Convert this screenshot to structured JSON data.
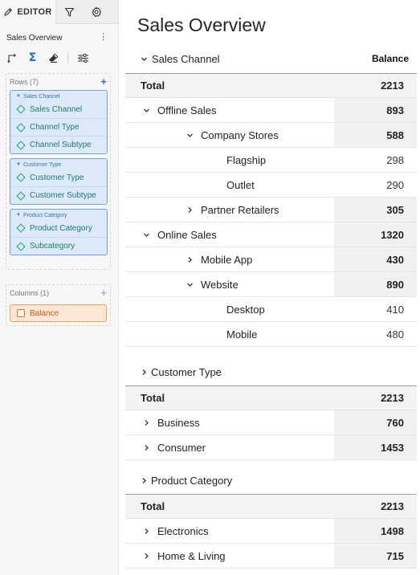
{
  "editor": {
    "tab_label": "EDITOR",
    "report_name": "Sales Overview",
    "tools": [
      "swap-axes-icon",
      "sigma-icon",
      "eraser-icon",
      "sliders-icon"
    ],
    "rows_header": "Rows (7)",
    "row_groups": [
      {
        "title": "Sales Channel",
        "fields": [
          "Sales Channel",
          "Channel Type",
          "Channel Subtype"
        ]
      },
      {
        "title": "Customer Type",
        "fields": [
          "Customer Type",
          "Customer Subtype"
        ]
      },
      {
        "title": "Product Category",
        "fields": [
          "Product Category",
          "Subcategory"
        ]
      }
    ],
    "columns_header": "Columns (1)",
    "measure": "Balance"
  },
  "report": {
    "title": "Sales Overview",
    "column_header": "Balance",
    "sections": [
      {
        "name": "Sales Channel",
        "expanded": true,
        "rows": [
          {
            "label": "Total",
            "value": "2213",
            "type": "total"
          },
          {
            "label": "Offline Sales",
            "value": "893",
            "level": 1,
            "chevron": "down"
          },
          {
            "label": "Company Stores",
            "value": "588",
            "level": 2,
            "chevron": "down"
          },
          {
            "label": "Flagship",
            "value": "298",
            "level": 3
          },
          {
            "label": "Outlet",
            "value": "290",
            "level": 3
          },
          {
            "label": "Partner Retailers",
            "value": "305",
            "level": 2,
            "chevron": "right"
          },
          {
            "label": "Online Sales",
            "value": "1320",
            "level": 1,
            "chevron": "down"
          },
          {
            "label": "Mobile App",
            "value": "430",
            "level": 2,
            "chevron": "right"
          },
          {
            "label": "Website",
            "value": "890",
            "level": 2,
            "chevron": "down"
          },
          {
            "label": "Desktop",
            "value": "410",
            "level": 3
          },
          {
            "label": "Mobile",
            "value": "480",
            "level": 3
          }
        ]
      },
      {
        "name": "Customer Type",
        "expanded": false,
        "rows": [
          {
            "label": "Total",
            "value": "2213",
            "type": "total"
          },
          {
            "label": "Business",
            "value": "760",
            "level": 1,
            "chevron": "right"
          },
          {
            "label": "Consumer",
            "value": "1453",
            "level": 1,
            "chevron": "right"
          }
        ]
      },
      {
        "name": "Product Category",
        "expanded": false,
        "rows": [
          {
            "label": "Total",
            "value": "2213",
            "type": "total"
          },
          {
            "label": "Electronics",
            "value": "1498",
            "level": 1,
            "chevron": "right"
          },
          {
            "label": "Home & Living",
            "value": "715",
            "level": 1,
            "chevron": "right"
          }
        ]
      }
    ]
  }
}
